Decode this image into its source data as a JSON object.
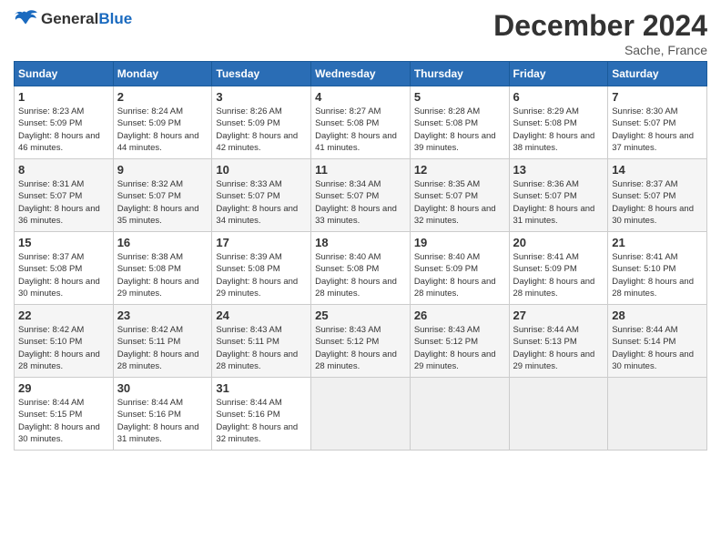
{
  "header": {
    "logo_general": "General",
    "logo_blue": "Blue",
    "month_title": "December 2024",
    "location": "Sache, France"
  },
  "days_of_week": [
    "Sunday",
    "Monday",
    "Tuesday",
    "Wednesday",
    "Thursday",
    "Friday",
    "Saturday"
  ],
  "weeks": [
    [
      {
        "day": "1",
        "sunrise": "Sunrise: 8:23 AM",
        "sunset": "Sunset: 5:09 PM",
        "daylight": "Daylight: 8 hours and 46 minutes."
      },
      {
        "day": "2",
        "sunrise": "Sunrise: 8:24 AM",
        "sunset": "Sunset: 5:09 PM",
        "daylight": "Daylight: 8 hours and 44 minutes."
      },
      {
        "day": "3",
        "sunrise": "Sunrise: 8:26 AM",
        "sunset": "Sunset: 5:09 PM",
        "daylight": "Daylight: 8 hours and 42 minutes."
      },
      {
        "day": "4",
        "sunrise": "Sunrise: 8:27 AM",
        "sunset": "Sunset: 5:08 PM",
        "daylight": "Daylight: 8 hours and 41 minutes."
      },
      {
        "day": "5",
        "sunrise": "Sunrise: 8:28 AM",
        "sunset": "Sunset: 5:08 PM",
        "daylight": "Daylight: 8 hours and 39 minutes."
      },
      {
        "day": "6",
        "sunrise": "Sunrise: 8:29 AM",
        "sunset": "Sunset: 5:08 PM",
        "daylight": "Daylight: 8 hours and 38 minutes."
      },
      {
        "day": "7",
        "sunrise": "Sunrise: 8:30 AM",
        "sunset": "Sunset: 5:07 PM",
        "daylight": "Daylight: 8 hours and 37 minutes."
      }
    ],
    [
      {
        "day": "8",
        "sunrise": "Sunrise: 8:31 AM",
        "sunset": "Sunset: 5:07 PM",
        "daylight": "Daylight: 8 hours and 36 minutes."
      },
      {
        "day": "9",
        "sunrise": "Sunrise: 8:32 AM",
        "sunset": "Sunset: 5:07 PM",
        "daylight": "Daylight: 8 hours and 35 minutes."
      },
      {
        "day": "10",
        "sunrise": "Sunrise: 8:33 AM",
        "sunset": "Sunset: 5:07 PM",
        "daylight": "Daylight: 8 hours and 34 minutes."
      },
      {
        "day": "11",
        "sunrise": "Sunrise: 8:34 AM",
        "sunset": "Sunset: 5:07 PM",
        "daylight": "Daylight: 8 hours and 33 minutes."
      },
      {
        "day": "12",
        "sunrise": "Sunrise: 8:35 AM",
        "sunset": "Sunset: 5:07 PM",
        "daylight": "Daylight: 8 hours and 32 minutes."
      },
      {
        "day": "13",
        "sunrise": "Sunrise: 8:36 AM",
        "sunset": "Sunset: 5:07 PM",
        "daylight": "Daylight: 8 hours and 31 minutes."
      },
      {
        "day": "14",
        "sunrise": "Sunrise: 8:37 AM",
        "sunset": "Sunset: 5:07 PM",
        "daylight": "Daylight: 8 hours and 30 minutes."
      }
    ],
    [
      {
        "day": "15",
        "sunrise": "Sunrise: 8:37 AM",
        "sunset": "Sunset: 5:08 PM",
        "daylight": "Daylight: 8 hours and 30 minutes."
      },
      {
        "day": "16",
        "sunrise": "Sunrise: 8:38 AM",
        "sunset": "Sunset: 5:08 PM",
        "daylight": "Daylight: 8 hours and 29 minutes."
      },
      {
        "day": "17",
        "sunrise": "Sunrise: 8:39 AM",
        "sunset": "Sunset: 5:08 PM",
        "daylight": "Daylight: 8 hours and 29 minutes."
      },
      {
        "day": "18",
        "sunrise": "Sunrise: 8:40 AM",
        "sunset": "Sunset: 5:08 PM",
        "daylight": "Daylight: 8 hours and 28 minutes."
      },
      {
        "day": "19",
        "sunrise": "Sunrise: 8:40 AM",
        "sunset": "Sunset: 5:09 PM",
        "daylight": "Daylight: 8 hours and 28 minutes."
      },
      {
        "day": "20",
        "sunrise": "Sunrise: 8:41 AM",
        "sunset": "Sunset: 5:09 PM",
        "daylight": "Daylight: 8 hours and 28 minutes."
      },
      {
        "day": "21",
        "sunrise": "Sunrise: 8:41 AM",
        "sunset": "Sunset: 5:10 PM",
        "daylight": "Daylight: 8 hours and 28 minutes."
      }
    ],
    [
      {
        "day": "22",
        "sunrise": "Sunrise: 8:42 AM",
        "sunset": "Sunset: 5:10 PM",
        "daylight": "Daylight: 8 hours and 28 minutes."
      },
      {
        "day": "23",
        "sunrise": "Sunrise: 8:42 AM",
        "sunset": "Sunset: 5:11 PM",
        "daylight": "Daylight: 8 hours and 28 minutes."
      },
      {
        "day": "24",
        "sunrise": "Sunrise: 8:43 AM",
        "sunset": "Sunset: 5:11 PM",
        "daylight": "Daylight: 8 hours and 28 minutes."
      },
      {
        "day": "25",
        "sunrise": "Sunrise: 8:43 AM",
        "sunset": "Sunset: 5:12 PM",
        "daylight": "Daylight: 8 hours and 28 minutes."
      },
      {
        "day": "26",
        "sunrise": "Sunrise: 8:43 AM",
        "sunset": "Sunset: 5:12 PM",
        "daylight": "Daylight: 8 hours and 29 minutes."
      },
      {
        "day": "27",
        "sunrise": "Sunrise: 8:44 AM",
        "sunset": "Sunset: 5:13 PM",
        "daylight": "Daylight: 8 hours and 29 minutes."
      },
      {
        "day": "28",
        "sunrise": "Sunrise: 8:44 AM",
        "sunset": "Sunset: 5:14 PM",
        "daylight": "Daylight: 8 hours and 30 minutes."
      }
    ],
    [
      {
        "day": "29",
        "sunrise": "Sunrise: 8:44 AM",
        "sunset": "Sunset: 5:15 PM",
        "daylight": "Daylight: 8 hours and 30 minutes."
      },
      {
        "day": "30",
        "sunrise": "Sunrise: 8:44 AM",
        "sunset": "Sunset: 5:16 PM",
        "daylight": "Daylight: 8 hours and 31 minutes."
      },
      {
        "day": "31",
        "sunrise": "Sunrise: 8:44 AM",
        "sunset": "Sunset: 5:16 PM",
        "daylight": "Daylight: 8 hours and 32 minutes."
      },
      null,
      null,
      null,
      null
    ]
  ]
}
